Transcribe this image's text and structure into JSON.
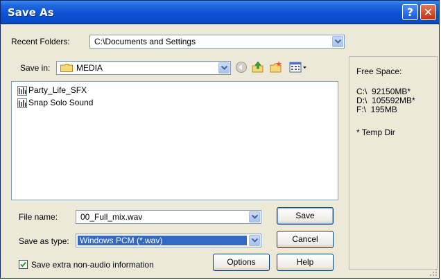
{
  "window": {
    "title": "Save As",
    "help_button": "?",
    "close_button": "✕"
  },
  "recent_folders": {
    "label": "Recent Folders:",
    "value": "C:\\Documents and Settings"
  },
  "save_in": {
    "label": "Save in:",
    "value": "MEDIA"
  },
  "toolbar": {
    "back_icon": "back-arrow-icon",
    "up_icon": "up-folder-icon",
    "new_folder_icon": "new-folder-icon",
    "view_menu_icon": "view-menu-icon"
  },
  "files": [
    {
      "name": "Party_Life_SFX"
    },
    {
      "name": "Snap Solo Sound"
    }
  ],
  "file_name": {
    "label": "File name:",
    "value": "00_Full_mix.wav"
  },
  "save_as_type": {
    "label": "Save as type:",
    "value": "Windows PCM (*.wav)"
  },
  "checkbox": {
    "label": "Save extra non-audio information",
    "checked": true
  },
  "buttons": {
    "save": "Save",
    "cancel": "Cancel",
    "options": "Options",
    "help": "Help"
  },
  "free_space": {
    "title": "Free Space:",
    "drives": [
      {
        "drive": "C:\\",
        "size": "92150MB*"
      },
      {
        "drive": "D:\\",
        "size": "105592MB*"
      },
      {
        "drive": "F:\\",
        "size": "195MB"
      }
    ],
    "note": "* Temp Dir"
  },
  "colors": {
    "titlebar": "#0a52d4",
    "dialog_bg": "#ece9d8",
    "selection": "#316ac5",
    "field_border": "#7f9db9"
  }
}
